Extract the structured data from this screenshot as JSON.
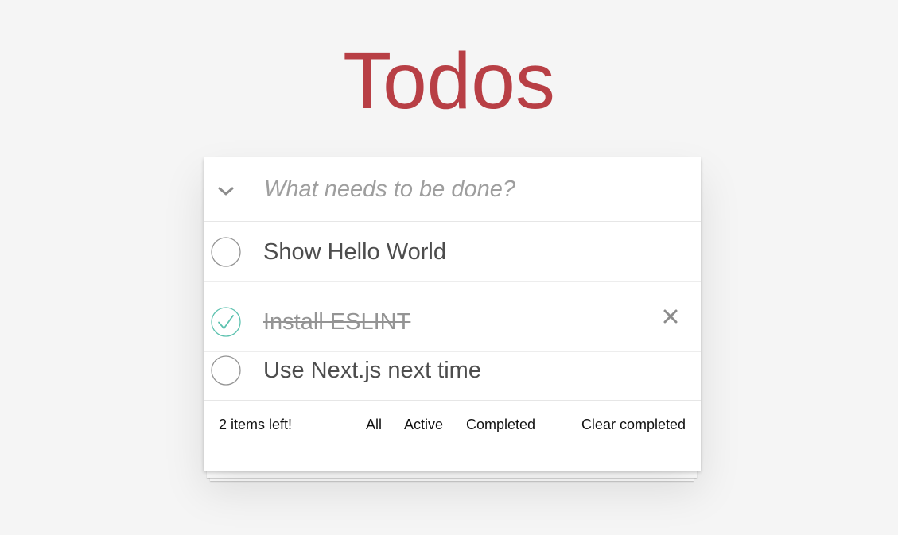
{
  "app": {
    "title": "Todos"
  },
  "new_todo": {
    "placeholder": "What needs to be done?",
    "value": ""
  },
  "todos": [
    {
      "label": "Show Hello World",
      "completed": false
    },
    {
      "label": "Install ESLINT",
      "completed": true
    },
    {
      "label": "Use Next.js next time",
      "completed": false
    }
  ],
  "footer": {
    "items_left": "2 items left!",
    "filters": [
      "All",
      "Active",
      "Completed"
    ],
    "clear_completed": "Clear completed"
  },
  "icons": {
    "toggle_all": "chevron-down-icon",
    "unchecked": "circle-icon",
    "checked": "checkmark-circle-icon",
    "destroy": "close-icon"
  },
  "colors": {
    "title": "#b83f45",
    "background": "#f5f5f5",
    "check": "#5dc2af",
    "completed_text": "#949494"
  }
}
